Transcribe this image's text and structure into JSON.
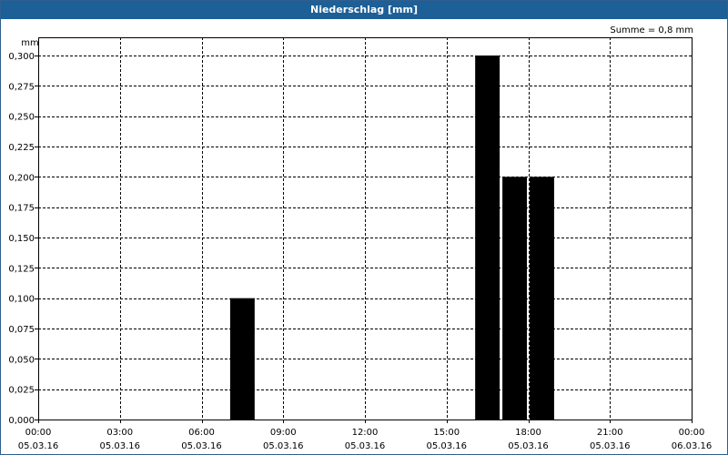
{
  "window": {
    "title": "Niederschlag [mm]"
  },
  "chart_data": {
    "type": "bar",
    "title": "Niederschlag [mm]",
    "ylabel": "mm",
    "annotation": "Summe = 0,8 mm",
    "ylim": [
      0,
      0.3
    ],
    "xlim_hours": [
      0,
      24
    ],
    "grid": true,
    "y_ticks": [
      "0,000",
      "0,025",
      "0,050",
      "0,075",
      "0,100",
      "0,125",
      "0,150",
      "0,175",
      "0,200",
      "0,225",
      "0,250",
      "0,275",
      "0,300"
    ],
    "x_ticks": [
      {
        "time": "00:00",
        "date": "05.03.16"
      },
      {
        "time": "03:00",
        "date": "05.03.16"
      },
      {
        "time": "06:00",
        "date": "05.03.16"
      },
      {
        "time": "09:00",
        "date": "05.03.16"
      },
      {
        "time": "12:00",
        "date": "05.03.16"
      },
      {
        "time": "15:00",
        "date": "05.03.16"
      },
      {
        "time": "18:00",
        "date": "05.03.16"
      },
      {
        "time": "21:00",
        "date": "05.03.16"
      },
      {
        "time": "00:00",
        "date": "06.03.16"
      }
    ],
    "bars": [
      {
        "start": "07:00",
        "end": "08:00",
        "value": 0.1
      },
      {
        "start": "16:00",
        "end": "17:00",
        "value": 0.3
      },
      {
        "start": "17:00",
        "end": "18:00",
        "value": 0.2
      },
      {
        "start": "18:00",
        "end": "19:00",
        "value": 0.2
      }
    ],
    "bar_color": "#000000",
    "grid_color": "#000000"
  }
}
